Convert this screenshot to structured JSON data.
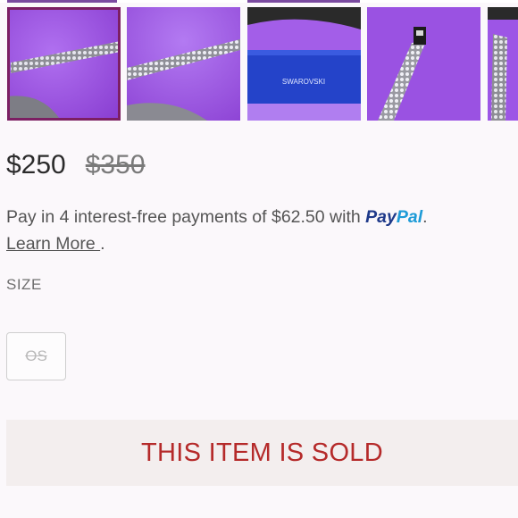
{
  "gallery": {
    "thumbnails": [
      {
        "name": "photo-bracelet-diagonal",
        "selected": true
      },
      {
        "name": "photo-bracelet-angle",
        "selected": false
      },
      {
        "name": "photo-swarovski-box",
        "selected": false,
        "box_text": "SWAROVSKI"
      },
      {
        "name": "photo-bracelet-clasp",
        "selected": false
      },
      {
        "name": "photo-bracelet-partial",
        "selected": false
      }
    ]
  },
  "pricing": {
    "price": "$250",
    "original_price": "$350"
  },
  "paypal": {
    "text": "Pay in 4 interest-free payments of $62.50 with",
    "logo_pay": "Pay",
    "logo_pal": "Pal",
    "period": ".",
    "learn_more": "Learn More ",
    "learn_more_period": "."
  },
  "size": {
    "label": "SIZE",
    "options": [
      {
        "value": "OS",
        "available": false
      }
    ]
  },
  "status": {
    "banner": "THIS ITEM IS SOLD"
  },
  "colors": {
    "accent_purple": "#7c1f63",
    "sold_red": "#b52a2a",
    "paypal_dark": "#1f3a8a",
    "paypal_light": "#1e9bd7",
    "product_purple": "#9c4fe0"
  }
}
